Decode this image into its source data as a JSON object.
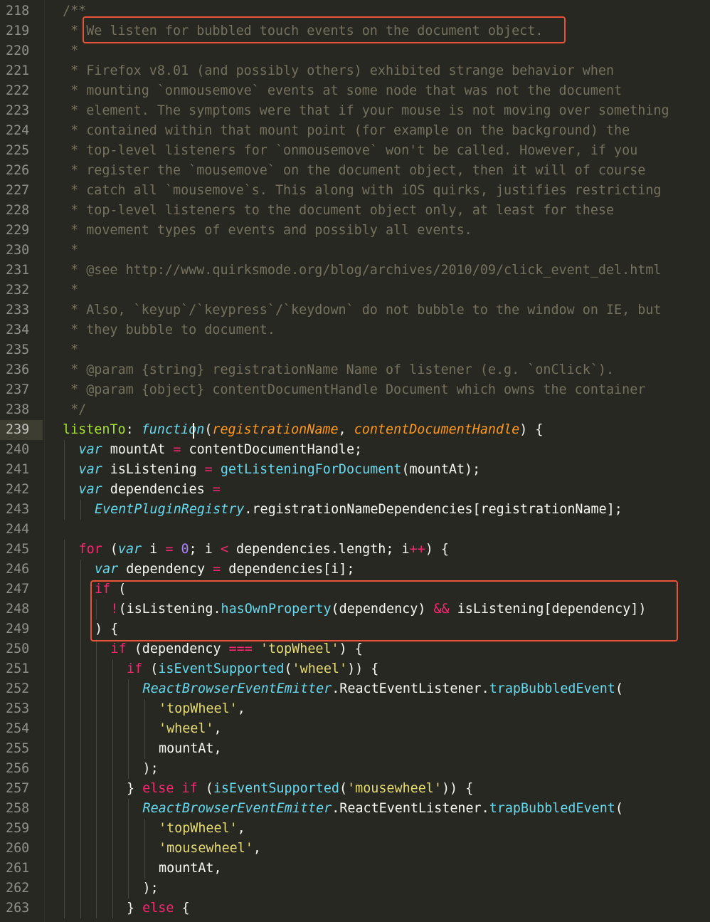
{
  "editor": {
    "theme": "Monokai",
    "colors": {
      "background": "#272822",
      "comment": "#75715e",
      "keyword": "#f92672",
      "storage": "#66d9ef",
      "parameter": "#fd971f",
      "property": "#a6e22e",
      "string": "#e6db74",
      "number": "#ae81ff",
      "plain": "#f8f8f2",
      "highlight_box": "#e8533a"
    },
    "current_line": 239,
    "highlighted_regions": [
      {
        "lines": [
          219,
          219
        ],
        "text": "We listen for bubbled touch events on the document object."
      },
      {
        "lines": [
          247,
          249
        ],
        "text": "if ( !(isListening.hasOwnProperty(dependency) && isListening[dependency]) ) {"
      }
    ],
    "lines": [
      {
        "n": "218",
        "indent": 0,
        "tokens": [
          [
            "c",
            "/**"
          ]
        ]
      },
      {
        "n": "219",
        "indent": 0,
        "tokens": [
          [
            "c",
            " * We listen for bubbled touch events on the document object."
          ]
        ]
      },
      {
        "n": "220",
        "indent": 0,
        "tokens": [
          [
            "c",
            " *"
          ]
        ]
      },
      {
        "n": "221",
        "indent": 0,
        "tokens": [
          [
            "c",
            " * Firefox v8.01 (and possibly others) exhibited strange behavior when"
          ]
        ]
      },
      {
        "n": "222",
        "indent": 0,
        "tokens": [
          [
            "c",
            " * mounting `onmousemove` events at some node that was not the document"
          ]
        ]
      },
      {
        "n": "223",
        "indent": 0,
        "tokens": [
          [
            "c",
            " * element. The symptoms were that if your mouse is not moving over something"
          ]
        ]
      },
      {
        "n": "224",
        "indent": 0,
        "tokens": [
          [
            "c",
            " * contained within that mount point (for example on the background) the"
          ]
        ]
      },
      {
        "n": "225",
        "indent": 0,
        "tokens": [
          [
            "c",
            " * top-level listeners for `onmousemove` won't be called. However, if you"
          ]
        ]
      },
      {
        "n": "226",
        "indent": 0,
        "tokens": [
          [
            "c",
            " * register the `mousemove` on the document object, then it will of course"
          ]
        ]
      },
      {
        "n": "227",
        "indent": 0,
        "tokens": [
          [
            "c",
            " * catch all `mousemove`s. This along with iOS quirks, justifies restricting"
          ]
        ]
      },
      {
        "n": "228",
        "indent": 0,
        "tokens": [
          [
            "c",
            " * top-level listeners to the document object only, at least for these"
          ]
        ]
      },
      {
        "n": "229",
        "indent": 0,
        "tokens": [
          [
            "c",
            " * movement types of events and possibly all events."
          ]
        ]
      },
      {
        "n": "230",
        "indent": 0,
        "tokens": [
          [
            "c",
            " *"
          ]
        ]
      },
      {
        "n": "231",
        "indent": 0,
        "tokens": [
          [
            "c",
            " * @see http://www.quirksmode.org/blog/archives/2010/09/click_event_del.html"
          ]
        ]
      },
      {
        "n": "232",
        "indent": 0,
        "tokens": [
          [
            "c",
            " *"
          ]
        ]
      },
      {
        "n": "233",
        "indent": 0,
        "tokens": [
          [
            "c",
            " * Also, `keyup`/`keypress`/`keydown` do not bubble to the window on IE, but"
          ]
        ]
      },
      {
        "n": "234",
        "indent": 0,
        "tokens": [
          [
            "c",
            " * they bubble to document."
          ]
        ]
      },
      {
        "n": "235",
        "indent": 0,
        "tokens": [
          [
            "c",
            " *"
          ]
        ]
      },
      {
        "n": "236",
        "indent": 0,
        "tokens": [
          [
            "c",
            " * @param {string} registrationName Name of listener (e.g. `onClick`)."
          ]
        ]
      },
      {
        "n": "237",
        "indent": 0,
        "tokens": [
          [
            "c",
            " * @param {object} contentDocumentHandle Document which owns the container"
          ]
        ]
      },
      {
        "n": "238",
        "indent": 0,
        "tokens": [
          [
            "c",
            " */"
          ]
        ]
      },
      {
        "n": "239",
        "indent": 0,
        "tokens": [
          [
            "prop",
            "listenTo"
          ],
          [
            "p",
            ": "
          ],
          [
            "s",
            "function"
          ],
          [
            "p",
            "("
          ],
          [
            "param",
            "registrationName"
          ],
          [
            "p",
            ", "
          ],
          [
            "param",
            "contentDocumentHandle"
          ],
          [
            "p",
            ") {"
          ]
        ]
      },
      {
        "n": "240",
        "indent": 1,
        "tokens": [
          [
            "s",
            "var"
          ],
          [
            "p",
            " mountAt "
          ],
          [
            "k",
            "="
          ],
          [
            "p",
            " contentDocumentHandle;"
          ]
        ]
      },
      {
        "n": "241",
        "indent": 1,
        "tokens": [
          [
            "s",
            "var"
          ],
          [
            "p",
            " isListening "
          ],
          [
            "k",
            "="
          ],
          [
            "p",
            " "
          ],
          [
            "f",
            "getListeningForDocument"
          ],
          [
            "p",
            "(mountAt);"
          ]
        ]
      },
      {
        "n": "242",
        "indent": 1,
        "tokens": [
          [
            "s",
            "var"
          ],
          [
            "p",
            " dependencies "
          ],
          [
            "k",
            "="
          ]
        ]
      },
      {
        "n": "243",
        "indent": 2,
        "tokens": [
          [
            "cls",
            "EventPluginRegistry"
          ],
          [
            "p",
            ".registrationNameDependencies[registrationName];"
          ]
        ]
      },
      {
        "n": "244",
        "indent": 0,
        "tokens": []
      },
      {
        "n": "245",
        "indent": 1,
        "tokens": [
          [
            "k",
            "for"
          ],
          [
            "p",
            " ("
          ],
          [
            "s",
            "var"
          ],
          [
            "p",
            " i "
          ],
          [
            "k",
            "="
          ],
          [
            "p",
            " "
          ],
          [
            "num",
            "0"
          ],
          [
            "p",
            "; i "
          ],
          [
            "k",
            "<"
          ],
          [
            "p",
            " dependencies.length; i"
          ],
          [
            "k",
            "++"
          ],
          [
            "p",
            ") {"
          ]
        ]
      },
      {
        "n": "246",
        "indent": 2,
        "tokens": [
          [
            "s",
            "var"
          ],
          [
            "p",
            " dependency "
          ],
          [
            "k",
            "="
          ],
          [
            "p",
            " dependencies[i];"
          ]
        ]
      },
      {
        "n": "247",
        "indent": 2,
        "tokens": [
          [
            "k",
            "if"
          ],
          [
            "p",
            " ("
          ]
        ]
      },
      {
        "n": "248",
        "indent": 3,
        "tokens": [
          [
            "k",
            "!"
          ],
          [
            "p",
            "(isListening."
          ],
          [
            "f",
            "hasOwnProperty"
          ],
          [
            "p",
            "(dependency) "
          ],
          [
            "k",
            "&&"
          ],
          [
            "p",
            " isListening[dependency])"
          ]
        ]
      },
      {
        "n": "249",
        "indent": 2,
        "tokens": [
          [
            "p",
            ") {"
          ]
        ]
      },
      {
        "n": "250",
        "indent": 3,
        "tokens": [
          [
            "k",
            "if"
          ],
          [
            "p",
            " (dependency "
          ],
          [
            "k",
            "==="
          ],
          [
            "p",
            " "
          ],
          [
            "str",
            "'topWheel'"
          ],
          [
            "p",
            ") {"
          ]
        ]
      },
      {
        "n": "251",
        "indent": 4,
        "tokens": [
          [
            "k",
            "if"
          ],
          [
            "p",
            " ("
          ],
          [
            "f",
            "isEventSupported"
          ],
          [
            "p",
            "("
          ],
          [
            "str",
            "'wheel'"
          ],
          [
            "p",
            ")) {"
          ]
        ]
      },
      {
        "n": "252",
        "indent": 5,
        "tokens": [
          [
            "cls",
            "ReactBrowserEventEmitter"
          ],
          [
            "p",
            ".ReactEventListener."
          ],
          [
            "f",
            "trapBubbledEvent"
          ],
          [
            "p",
            "("
          ]
        ]
      },
      {
        "n": "253",
        "indent": 6,
        "tokens": [
          [
            "str",
            "'topWheel'"
          ],
          [
            "p",
            ","
          ]
        ]
      },
      {
        "n": "254",
        "indent": 6,
        "tokens": [
          [
            "str",
            "'wheel'"
          ],
          [
            "p",
            ","
          ]
        ]
      },
      {
        "n": "255",
        "indent": 6,
        "tokens": [
          [
            "p",
            "mountAt,"
          ]
        ]
      },
      {
        "n": "256",
        "indent": 5,
        "tokens": [
          [
            "p",
            ");"
          ]
        ]
      },
      {
        "n": "257",
        "indent": 4,
        "tokens": [
          [
            "p",
            "} "
          ],
          [
            "k",
            "else if"
          ],
          [
            "p",
            " ("
          ],
          [
            "f",
            "isEventSupported"
          ],
          [
            "p",
            "("
          ],
          [
            "str",
            "'mousewheel'"
          ],
          [
            "p",
            ")) {"
          ]
        ]
      },
      {
        "n": "258",
        "indent": 5,
        "tokens": [
          [
            "cls",
            "ReactBrowserEventEmitter"
          ],
          [
            "p",
            ".ReactEventListener."
          ],
          [
            "f",
            "trapBubbledEvent"
          ],
          [
            "p",
            "("
          ]
        ]
      },
      {
        "n": "259",
        "indent": 6,
        "tokens": [
          [
            "str",
            "'topWheel'"
          ],
          [
            "p",
            ","
          ]
        ]
      },
      {
        "n": "260",
        "indent": 6,
        "tokens": [
          [
            "str",
            "'mousewheel'"
          ],
          [
            "p",
            ","
          ]
        ]
      },
      {
        "n": "261",
        "indent": 6,
        "tokens": [
          [
            "p",
            "mountAt,"
          ]
        ]
      },
      {
        "n": "262",
        "indent": 5,
        "tokens": [
          [
            "p",
            ");"
          ]
        ]
      },
      {
        "n": "263",
        "indent": 4,
        "tokens": [
          [
            "p",
            "} "
          ],
          [
            "k",
            "else"
          ],
          [
            "p",
            " {"
          ]
        ]
      }
    ]
  }
}
